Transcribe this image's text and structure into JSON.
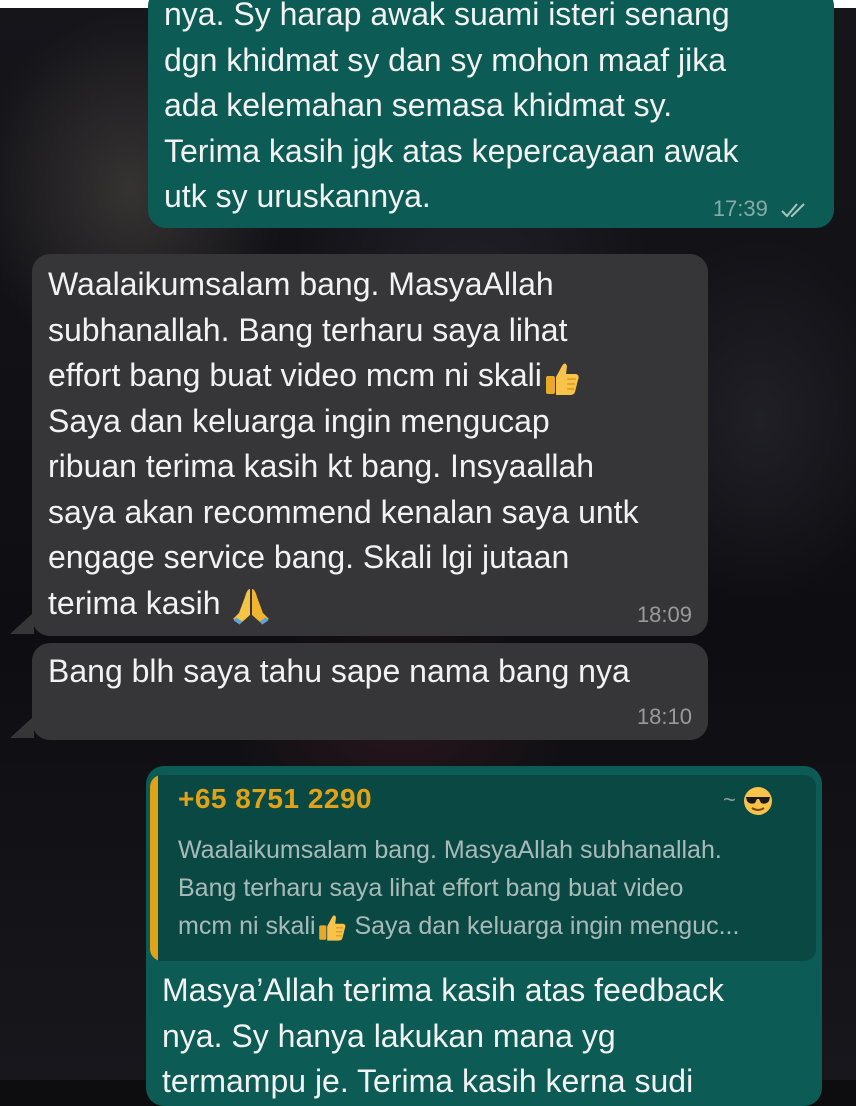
{
  "messages": {
    "m1": {
      "text": "nya. Sy harap awak suami isteri senang\ndgn khidmat sy dan sy mohon maaf jika\nada kelemahan semasa khidmat sy.\nTerima kasih jgk atas kepercayaan awak\nutk sy uruskannya.",
      "time": "17:39",
      "status_icon": "read-ticks-icon"
    },
    "m2": {
      "text_part1": "Waalaikumsalam bang. MasyaAllah\nsubhanallah. Bang terharu saya lihat\neffort bang buat video mcm ni skali",
      "emoji1": "thumbs-up-icon",
      "text_part2": "\nSaya dan keluarga ingin mengucap\nribuan terima kasih kt bang. Insyaallah\nsaya akan recommend kenalan saya untk\nengage service bang. Skali lgi jutaan\nterima kasih ",
      "emoji2": "folded-hands-icon",
      "time": "18:09"
    },
    "m3": {
      "text": "Bang blh saya tahu sape nama bang nya",
      "time": "18:10"
    },
    "m4": {
      "quote": {
        "sender": "+65 8751 2290",
        "pushname": "~",
        "pushname_emoji": "sunglasses-face-icon",
        "text_part1": "Waalaikumsalam bang. MasyaAllah subhanallah.\nBang terharu saya lihat effort bang buat video\nmcm ni skali",
        "emoji": "thumbs-up-icon",
        "text_part2": " Saya dan keluarga ingin menguc..."
      },
      "text": "Masya’Allah terima kasih atas feedback\nnya. Sy hanya lakukan mana yg\ntermampu je. Terima kasih kerna sudi"
    }
  },
  "colors": {
    "outgoing_bubble": "#0c5b54",
    "incoming_bubble": "#363638",
    "quote_accent": "#e0a317",
    "tick_color": "#a8c4c0"
  }
}
